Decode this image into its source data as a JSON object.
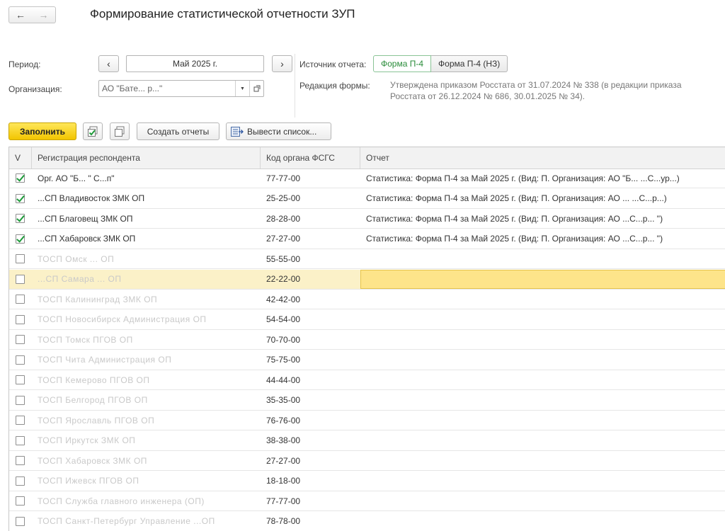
{
  "header": {
    "title": "Формирование статистической отчетности ЗУП"
  },
  "nav": {
    "back": "🡐",
    "forward": "🡒"
  },
  "period": {
    "label": "Период:",
    "value": "Май 2025 г.",
    "prev": "‹",
    "next": "›"
  },
  "organization": {
    "label": "Организация:",
    "value": "АО \"Бате...   р...\""
  },
  "source": {
    "label": "Источник отчета:",
    "options": [
      "Форма П-4",
      "Форма П-4 (НЗ)"
    ]
  },
  "edition": {
    "label": "Редакция формы:",
    "text": "Утверждена приказом Росстата от 31.07.2024 № 338 (в редакции приказа Росстата от 26.12.2024 № 686, 30.01.2025 № 34)."
  },
  "toolbar": {
    "fill": "Заполнить",
    "create_reports": "Создать отчеты",
    "export_list": "Вывести список..."
  },
  "grid": {
    "columns": [
      "V",
      "Регистрация респондента",
      "Код органа ФСГС",
      "Отчет"
    ],
    "rows": [
      {
        "checked": true,
        "name": "Орг. АО \"Б...   \" С...п\"",
        "code": "77-77-00",
        "report": "Статистика: Форма П-4 за Май 2025 г. (Вид: П. Организация: АО \"Б...   ...С...ур...)"
      },
      {
        "checked": true,
        "name": "...СП Владивосток ЗМК ОП",
        "code": "25-25-00",
        "report": "Статистика: Форма П-4 за Май 2025 г. (Вид: П. Организация: АО  ...  ...С...р...)"
      },
      {
        "checked": true,
        "name": "...СП Благовещ ЗМК ОП",
        "code": "28-28-00",
        "report": "Статистика: Форма П-4 за Май 2025 г. (Вид: П. Организация: АО  ...С...р... \")"
      },
      {
        "checked": true,
        "name": "...СП Хабаровск ЗМК ОП",
        "code": "27-27-00",
        "report": "Статистика: Форма П-4 за Май 2025 г. (Вид: П. Организация: АО  ...С...р... \")"
      },
      {
        "checked": false,
        "name": "ТОСП Омск ... ОП",
        "code": "55-55-00",
        "report": ""
      },
      {
        "checked": false,
        "name": "...СП Самара ... ОП",
        "code": "22-22-00",
        "report": "",
        "current": true
      },
      {
        "checked": false,
        "name": "ТОСП Калининград ЗМК ОП",
        "code": "42-42-00",
        "report": ""
      },
      {
        "checked": false,
        "name": "ТОСП Новосибирск Администрация ОП",
        "code": "54-54-00",
        "report": ""
      },
      {
        "checked": false,
        "name": "ТОСП Томск ПГОВ ОП",
        "code": "70-70-00",
        "report": ""
      },
      {
        "checked": false,
        "name": "ТОСП Чита Администрация ОП",
        "code": "75-75-00",
        "report": ""
      },
      {
        "checked": false,
        "name": "ТОСП Кемерово ПГОВ ОП",
        "code": "44-44-00",
        "report": ""
      },
      {
        "checked": false,
        "name": "ТОСП Белгород ПГОВ ОП",
        "code": "35-35-00",
        "report": ""
      },
      {
        "checked": false,
        "name": "ТОСП Ярославль ПГОВ ОП",
        "code": "76-76-00",
        "report": ""
      },
      {
        "checked": false,
        "name": "ТОСП Иркутск ЗМК ОП",
        "code": "38-38-00",
        "report": ""
      },
      {
        "checked": false,
        "name": "ТОСП Хабаровск ЗМК ОП",
        "code": "27-27-00",
        "report": ""
      },
      {
        "checked": false,
        "name": "ТОСП Ижевск ПГОВ ОП",
        "code": "18-18-00",
        "report": ""
      },
      {
        "checked": false,
        "name": "ТОСП Служба главного инженера (ОП)",
        "code": "77-77-00",
        "report": ""
      },
      {
        "checked": false,
        "name": "ТОСП Санкт-Петербург Управление ...ОП",
        "code": "78-78-00",
        "report": ""
      }
    ]
  }
}
